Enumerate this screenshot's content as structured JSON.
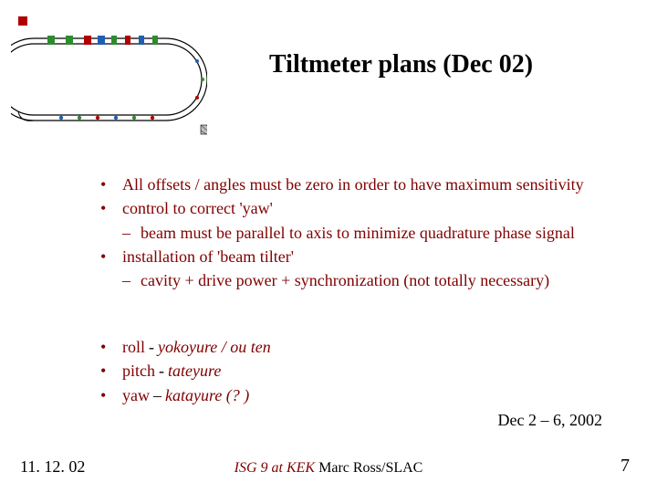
{
  "title": "Tiltmeter plans (Dec 02)",
  "bullets_main": [
    {
      "text": "All offsets / angles must be zero in order to have maximum sensitivity",
      "subs": []
    },
    {
      "text": "control to correct 'yaw'",
      "subs": [
        "beam must be parallel to axis to minimize quadrature phase signal"
      ]
    },
    {
      "text": "installation of 'beam tilter'",
      "subs": [
        "cavity + drive power + synchronization (not totally necessary)"
      ]
    }
  ],
  "bullets_terms": [
    {
      "label": "roll  ",
      "sep": "- ",
      "term": "yokoyure / ou ten"
    },
    {
      "label": "pitch ",
      "sep": "- ",
      "term": "tateyure"
    },
    {
      "label": "yaw ",
      "sep": "– ",
      "term": "katayure (? )"
    }
  ],
  "date_line": "Dec 2 – 6, 2002",
  "footer_date": "11. 12. 02",
  "footer_event": "ISG 9 at KEK",
  "footer_author": " Marc Ross/SLAC",
  "page_num": "7"
}
